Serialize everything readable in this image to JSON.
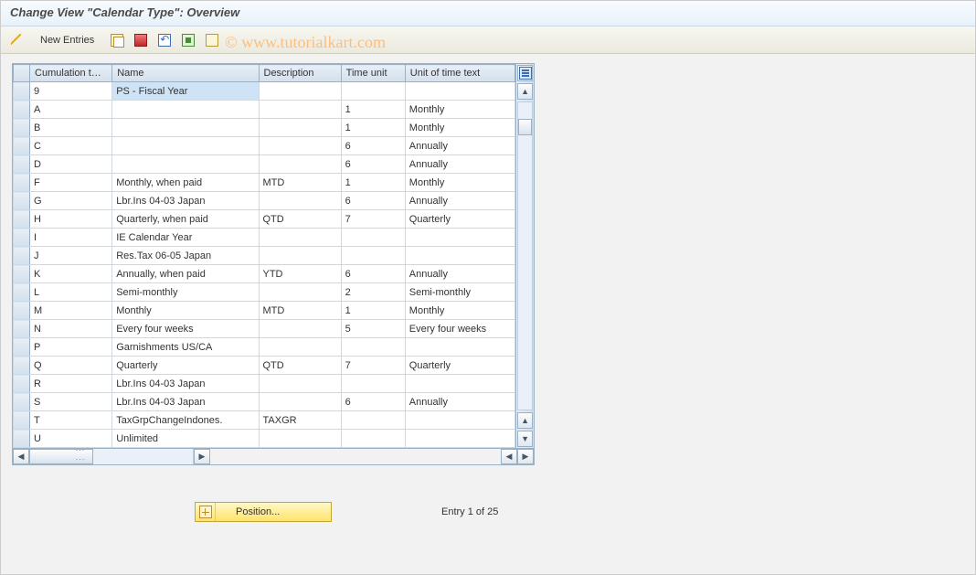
{
  "title": "Change View \"Calendar Type\": Overview",
  "toolbar": {
    "new_entries": "New Entries"
  },
  "watermark": "© www.tutorialkart.com",
  "columns": {
    "cumulation": "Cumulation t…",
    "name": "Name",
    "description": "Description",
    "time_unit": "Time unit",
    "unit_text": "Unit of time text"
  },
  "rows": [
    {
      "key": "9",
      "name": "PS - Fiscal Year",
      "desc": "",
      "tu": "",
      "ut": "",
      "sel": true
    },
    {
      "key": "A",
      "name": "",
      "desc": "",
      "tu": "1",
      "ut": "Monthly"
    },
    {
      "key": "B",
      "name": "",
      "desc": "",
      "tu": "1",
      "ut": "Monthly"
    },
    {
      "key": "C",
      "name": "",
      "desc": "",
      "tu": "6",
      "ut": "Annually"
    },
    {
      "key": "D",
      "name": "",
      "desc": "",
      "tu": "6",
      "ut": "Annually"
    },
    {
      "key": "F",
      "name": "Monthly, when paid",
      "desc": "MTD",
      "tu": "1",
      "ut": "Monthly"
    },
    {
      "key": "G",
      "name": "Lbr.Ins 04-03  Japan",
      "desc": "",
      "tu": "6",
      "ut": "Annually"
    },
    {
      "key": "H",
      "name": "Quarterly, when paid",
      "desc": "QTD",
      "tu": "7",
      "ut": "Quarterly"
    },
    {
      "key": "I",
      "name": "IE Calendar Year",
      "desc": "",
      "tu": "",
      "ut": ""
    },
    {
      "key": "J",
      "name": "Res.Tax 06-05  Japan",
      "desc": "",
      "tu": "",
      "ut": ""
    },
    {
      "key": "K",
      "name": "Annually, when paid",
      "desc": "YTD",
      "tu": "6",
      "ut": "Annually"
    },
    {
      "key": "L",
      "name": "Semi-monthly",
      "desc": "",
      "tu": "2",
      "ut": "Semi-monthly"
    },
    {
      "key": "M",
      "name": "Monthly",
      "desc": "MTD",
      "tu": "1",
      "ut": "Monthly"
    },
    {
      "key": "N",
      "name": "Every four weeks",
      "desc": "",
      "tu": "5",
      "ut": "Every four weeks"
    },
    {
      "key": "P",
      "name": "Garnishments US/CA",
      "desc": "",
      "tu": "",
      "ut": ""
    },
    {
      "key": "Q",
      "name": "Quarterly",
      "desc": "QTD",
      "tu": "7",
      "ut": "Quarterly"
    },
    {
      "key": "R",
      "name": "Lbr.Ins 04-03  Japan",
      "desc": "",
      "tu": "",
      "ut": ""
    },
    {
      "key": "S",
      "name": "Lbr.Ins 04-03  Japan",
      "desc": "",
      "tu": "6",
      "ut": "Annually"
    },
    {
      "key": "T",
      "name": "TaxGrpChangeIndones.",
      "desc": "TAXGR",
      "tu": "",
      "ut": ""
    },
    {
      "key": "U",
      "name": "Unlimited",
      "desc": "",
      "tu": "",
      "ut": ""
    }
  ],
  "footer": {
    "position_label": "Position...",
    "entry_text": "Entry 1 of 25"
  }
}
